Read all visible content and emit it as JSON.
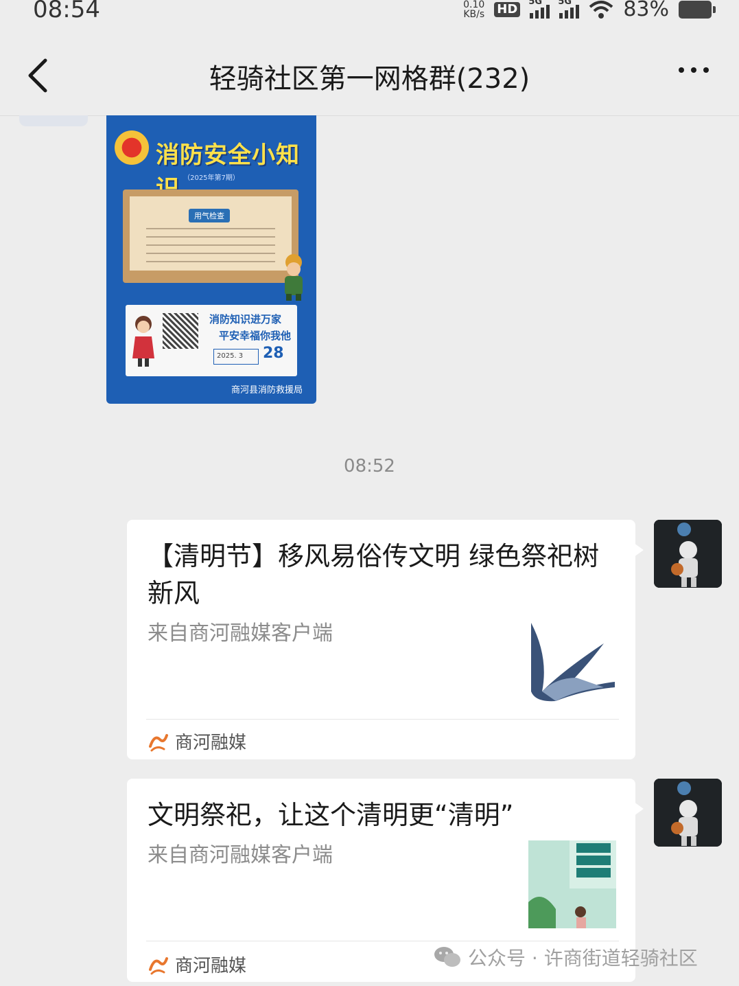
{
  "status_bar": {
    "time": "08:54",
    "net_speed_value": "0.10",
    "net_speed_unit": "KB/s",
    "hd_label": "HD",
    "sim1_label": "5G",
    "sim2_label": "5G",
    "battery_percent": "83%",
    "icons": [
      "signal-icon",
      "wifi-icon",
      "battery-icon"
    ]
  },
  "header": {
    "title": "轻骑社区第一网格群(232)",
    "back_icon": "back-chevron-icon",
    "more_icon": "more-dots-icon"
  },
  "poster": {
    "title": "消防安全小知识",
    "year_note": "（2025年第7期）",
    "board_tag": "用气检查",
    "slogan_1": "消防知识进万家",
    "slogan_2": "平安幸福你我他",
    "date": "2025. 3",
    "day": "28",
    "footer": "商河县消防救援局"
  },
  "timestamp": "08:52",
  "messages": [
    {
      "title": "【清明节】移风易俗传文明 绿色祭祀树新风",
      "source": "来自商河融媒客户端",
      "footer_label": "商河融媒",
      "thumb_icon": "swallow-image"
    },
    {
      "title": "文明祭祀，让这个清明更“清明”",
      "source": "来自商河融媒客户端",
      "footer_label": "商河融媒",
      "thumb_icon": "qingming-poster-image"
    }
  ],
  "watermark": {
    "text": "公众号 · 许商街道轻骑社区",
    "icon": "wechat-icon"
  },
  "colors": {
    "background": "#ededed",
    "poster_blue": "#1e5fb4",
    "poster_yellow": "#ffe14a",
    "brand_orange": "#e8772e"
  }
}
